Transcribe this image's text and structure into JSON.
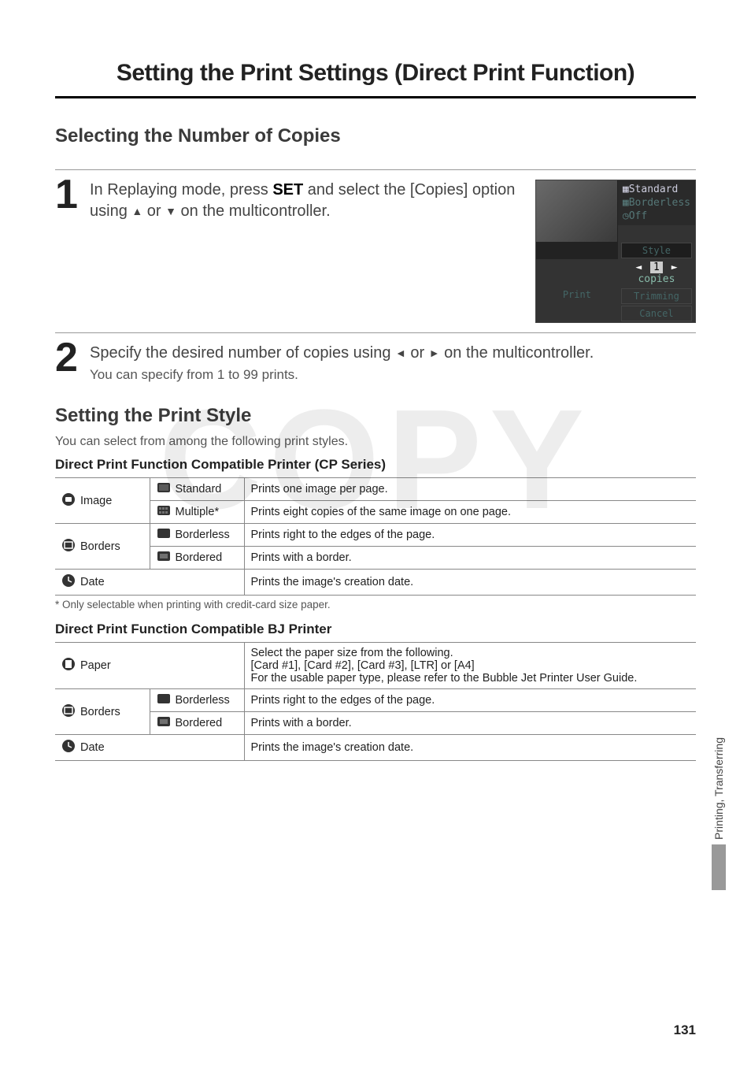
{
  "chapter_title": "Setting the Print Settings (Direct Print Function)",
  "section1_title": "Selecting the Number of Copies",
  "step1": {
    "num": "1",
    "lead_a": "In Replaying mode, press ",
    "set_key": "SET",
    "lead_b": " and select the [Copies] option using ",
    "lead_c": " or ",
    "lead_d": " on the multicontroller."
  },
  "lcd": {
    "opt1_icon_hint": "size-icon",
    "opt1": "Standard",
    "opt2_icon_hint": "border-icon",
    "opt2": "Borderless",
    "opt3_icon_hint": "clock-icon",
    "opt3": "Off",
    "style": "Style",
    "copies_left": "◄",
    "copies_val": "1",
    "copies_right": "►",
    "copies_label": "copies",
    "trimming": "Trimming",
    "print": "Print",
    "cancel": "Cancel"
  },
  "step2": {
    "num": "2",
    "lead_a": "Specify the desired number of copies using ",
    "lead_b": " or ",
    "lead_c": " on the multicontroller.",
    "sub": "You can specify from 1 to 99 prints."
  },
  "section2_title": "Setting the Print Style",
  "section2_intro": "You can select from among the following print styles.",
  "cp_heading": "Direct Print Function Compatible Printer (CP Series)",
  "cp_rows": {
    "image_label": "Image",
    "standard": "Standard",
    "standard_desc": "Prints one image per page.",
    "multiple": "Multiple*",
    "multiple_desc": "Prints eight copies of the same image on one page.",
    "borders_label": "Borders",
    "borderless": "Borderless",
    "borderless_desc": "Prints right to the edges of the page.",
    "bordered": "Bordered",
    "bordered_desc": "Prints with a border.",
    "date_label": "Date",
    "date_desc": "Prints the image's creation date."
  },
  "cp_footnote": "* Only selectable when printing with credit-card size paper.",
  "bj_heading": "Direct Print Function Compatible BJ Printer",
  "bj_rows": {
    "paper_label": "Paper",
    "paper_desc1": "Select the paper size from the following.",
    "paper_desc2": "[Card #1], [Card #2], [Card #3], [LTR] or [A4]",
    "paper_desc3": "For the usable paper type, please refer to the Bubble Jet Printer User Guide.",
    "borders_label": "Borders",
    "borderless": "Borderless",
    "borderless_desc": "Prints right to the edges of the page.",
    "bordered": "Bordered",
    "bordered_desc": "Prints with a border.",
    "date_label": "Date",
    "date_desc": "Prints the image's creation date."
  },
  "side_tab": "Printing, Transferring",
  "page_num": "131",
  "watermark": "COPY"
}
